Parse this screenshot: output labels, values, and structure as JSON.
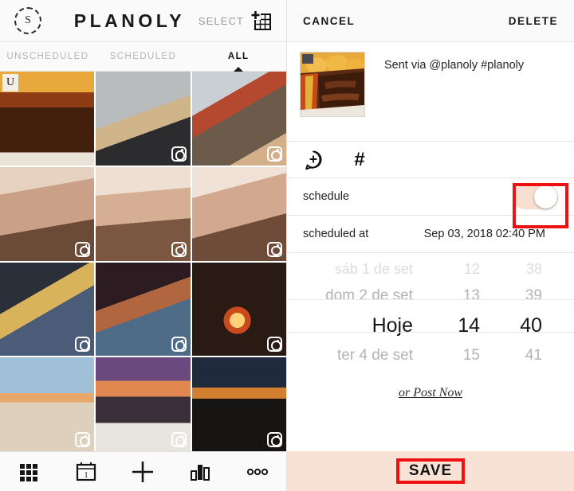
{
  "app": {
    "brand": "PLANOLY",
    "select_label": "SELECT",
    "story_icon_letter": "S"
  },
  "tabs": [
    {
      "label": "UNSCHEDULED",
      "active": false
    },
    {
      "label": "SCHEDULED",
      "active": false
    },
    {
      "label": "ALL",
      "active": true
    }
  ],
  "grid": {
    "badge_unscheduled": "U",
    "cells": [
      {
        "id": "cell-1",
        "selected": true,
        "unscheduled_badge": true,
        "instagram_badge": false,
        "alt": "chocolate dessert on plate"
      },
      {
        "id": "cell-2",
        "selected": false,
        "unscheduled_badge": false,
        "instagram_badge": true,
        "alt": "sneakers on pavement"
      },
      {
        "id": "cell-3",
        "selected": false,
        "unscheduled_badge": false,
        "instagram_badge": true,
        "alt": "woman sitting outdoors"
      },
      {
        "id": "cell-4",
        "selected": false,
        "unscheduled_badge": false,
        "instagram_badge": true,
        "alt": "portrait hand on chin"
      },
      {
        "id": "cell-5",
        "selected": false,
        "unscheduled_badge": false,
        "instagram_badge": true,
        "alt": "portrait white shirt"
      },
      {
        "id": "cell-6",
        "selected": false,
        "unscheduled_badge": false,
        "instagram_badge": true,
        "alt": "portrait close up"
      },
      {
        "id": "cell-7",
        "selected": false,
        "unscheduled_badge": false,
        "instagram_badge": true,
        "alt": "dancing at night"
      },
      {
        "id": "cell-8",
        "selected": false,
        "unscheduled_badge": false,
        "instagram_badge": true,
        "alt": "woman with sombrero"
      },
      {
        "id": "cell-9",
        "selected": false,
        "unscheduled_badge": false,
        "instagram_badge": true,
        "alt": "blowing birthday candles"
      },
      {
        "id": "cell-10",
        "selected": false,
        "unscheduled_badge": false,
        "instagram_badge": true,
        "alt": "beach denim jacket"
      },
      {
        "id": "cell-11",
        "selected": false,
        "unscheduled_badge": false,
        "instagram_badge": true,
        "alt": "sunset portrait friends shirt"
      },
      {
        "id": "cell-12",
        "selected": false,
        "unscheduled_badge": false,
        "instagram_badge": true,
        "alt": "silhouette at sunset"
      }
    ]
  },
  "bottom_nav": [
    {
      "name": "grid-icon",
      "label": "grid"
    },
    {
      "name": "calendar-icon",
      "label": "calendar",
      "day": "1"
    },
    {
      "name": "plus-icon",
      "label": "add"
    },
    {
      "name": "analytics-icon",
      "label": "analytics"
    },
    {
      "name": "more-icon",
      "label": "more"
    }
  ],
  "editor": {
    "cancel_label": "CANCEL",
    "delete_label": "DELETE",
    "caption": "Sent via @planoly #planoly",
    "tools": [
      {
        "name": "add-comment-icon",
        "label": "add comment"
      },
      {
        "name": "hashtag-icon",
        "label": "#"
      }
    ],
    "schedule": {
      "label": "schedule",
      "enabled": true
    },
    "scheduled_at": {
      "label": "scheduled at",
      "value": "Sep 03, 2018 02:40 PM"
    },
    "picker": {
      "rows": [
        {
          "day": "sáb 1 de set",
          "hour": "12",
          "minute": "38",
          "state": "faint"
        },
        {
          "day": "dom 2 de set",
          "hour": "13",
          "minute": "39",
          "state": "dim"
        },
        {
          "day": "Hoje",
          "hour": "14",
          "minute": "40",
          "state": "center"
        },
        {
          "day": "ter 4 de set",
          "hour": "15",
          "minute": "41",
          "state": "dim"
        }
      ]
    },
    "post_now_label": "or Post Now",
    "save_label": "SAVE"
  },
  "colors": {
    "accent_peach": "#f8e2d6",
    "toggle_track": "#f7e0d2",
    "annotation_red": "#ee1111",
    "text_dark": "#1a1a1a",
    "text_muted": "#b4b4b4"
  }
}
